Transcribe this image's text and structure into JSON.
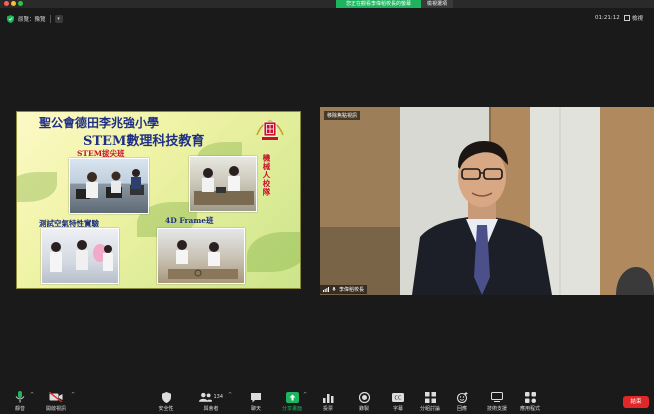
{
  "titlebar": {
    "share_status": "您正在觀看李偉稻校長的螢幕",
    "view_options": "檢視選項"
  },
  "topbar": {
    "view_mode": "原覽：豫覽",
    "timer": "01:21:12",
    "view_label": "檢視"
  },
  "slide": {
    "school_title": "聖公會德田李兆強小學",
    "stem_title": "STEM數理科技教育",
    "stem_elite_label": "STEM拔尖班",
    "robot_team_label": "機械人校隊",
    "experiment_label": "測試空氣特性實驗",
    "frame_label": "4D Frame班"
  },
  "video": {
    "top_label": "移除焦點視訊",
    "speaker_name": "李偉稻校長"
  },
  "toolbar": {
    "mute_label": "靜音",
    "start_video_label": "開啟視訊",
    "security_label": "安全性",
    "participants_label": "與會者",
    "participants_count": "134",
    "chat_label": "聊天",
    "share_screen_label": "分享畫面",
    "polls_label": "投票",
    "record_label": "錄製",
    "captions_label": "字幕",
    "breakout_label": "分組討論",
    "reactions_label": "回應",
    "tech_support_label": "技術支援",
    "apps_label": "應用程式",
    "end_label": "結束"
  },
  "colors": {
    "share_green": "#1eb35f",
    "end_red": "#e02828",
    "slide_title_blue": "#1e2f85",
    "slide_label_red": "#c8102e"
  }
}
